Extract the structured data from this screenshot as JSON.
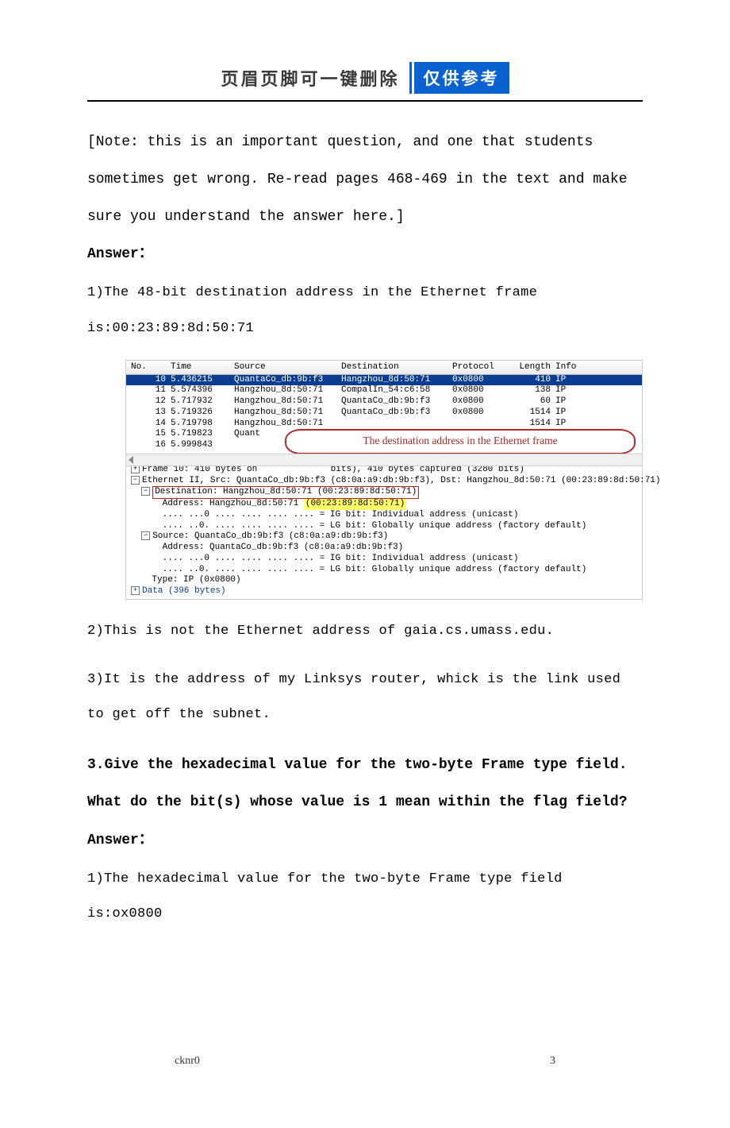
{
  "header": {
    "title": "页眉页脚可一键删除",
    "badge": "仅供参考"
  },
  "body": {
    "note": "[Note: this is an important question, and one that students sometimes get wrong. Re-read pages 468-469 in the text and make sure you understand the answer here.]",
    "answer_label": "Answer：",
    "ans1": "1)The 48-bit destination address in the Ethernet frame is:00:23:89:8d:50:71",
    "ans2": "2)This is not the Ethernet address of gaia.cs.umass.edu.",
    "ans3": "3)It is the address of my Linksys router, whick is the link used to get off  the subnet.",
    "q3": "3.Give the hexadecimal value for the two-byte Frame type field. What do the bit(s) whose value is 1 mean within the flag field?",
    "ans_q3_1": "1)The hexadecimal value for the two-byte Frame type field is:ox0800"
  },
  "wireshark": {
    "headers": {
      "no": "No.",
      "time": "Time",
      "source": "Source",
      "dest": "Destination",
      "proto": "Protocol",
      "len": "Length",
      "info": "Info"
    },
    "rows": [
      {
        "no": "10",
        "time": "5.436215",
        "source": "QuantaCo_db:9b:f3",
        "dest": "Hangzhou_8d:50:71",
        "proto": "0x0800",
        "len": "410",
        "info": "IP",
        "sel": true
      },
      {
        "no": "11",
        "time": "5.574396",
        "source": "Hangzhou_8d:50:71",
        "dest": "CompalIn_54:c6:58",
        "proto": "0x0800",
        "len": "138",
        "info": "IP"
      },
      {
        "no": "12",
        "time": "5.717932",
        "source": "Hangzhou_8d:50:71",
        "dest": "QuantaCo_db:9b:f3",
        "proto": "0x0800",
        "len": "60",
        "info": "IP"
      },
      {
        "no": "13",
        "time": "5.719326",
        "source": "Hangzhou_8d:50:71",
        "dest": "QuantaCo_db:9b:f3",
        "proto": "0x0800",
        "len": "1514",
        "info": "IP"
      },
      {
        "no": "14",
        "time": "5.719798",
        "source": "Hangzhou_8d:50:71",
        "dest": "",
        "proto": "",
        "len": "1514",
        "info": "IP"
      },
      {
        "no": "15",
        "time": "5.719823",
        "source": "Quant",
        "dest": "",
        "proto": "",
        "len": "",
        "info": ""
      },
      {
        "no": "16",
        "time": "5.999843",
        "source": "",
        "dest": "",
        "proto": "",
        "len": "",
        "info": ""
      }
    ],
    "callout": "The destination address in the Ethernet frame",
    "detail": {
      "frame": "Frame 10: 410 bytes on              bits), 410 bytes captured (3280 bits)",
      "eth": "Ethernet II, Src: QuantaCo_db:9b:f3 (c8:0a:a9:db:9b:f3), Dst: Hangzhou_8d:50:71 (00:23:89:8d:50:71)",
      "dest": "Destination: Hangzhou_8d:50:71 (00:23:89:8d:50:71)",
      "dest_addr_pre": "Address: Hangzhou_8d:50:71 ",
      "dest_addr_hl": "(00:23:89:8d:50:71)",
      "ig": ".... ...0 .... .... .... .... = IG bit: Individual address (unicast)",
      "lg": ".... ..0. .... .... .... .... = LG bit: Globally unique address (factory default)",
      "src": "Source: QuantaCo_db:9b:f3 (c8:0a:a9:db:9b:f3)",
      "src_addr": "Address: QuantaCo_db:9b:f3 (c8:0a:a9:db:9b:f3)",
      "type": "Type: IP (0x0800)",
      "data": "Data (396 bytes)"
    }
  },
  "footer": {
    "left": "cknr0",
    "right": "3"
  }
}
